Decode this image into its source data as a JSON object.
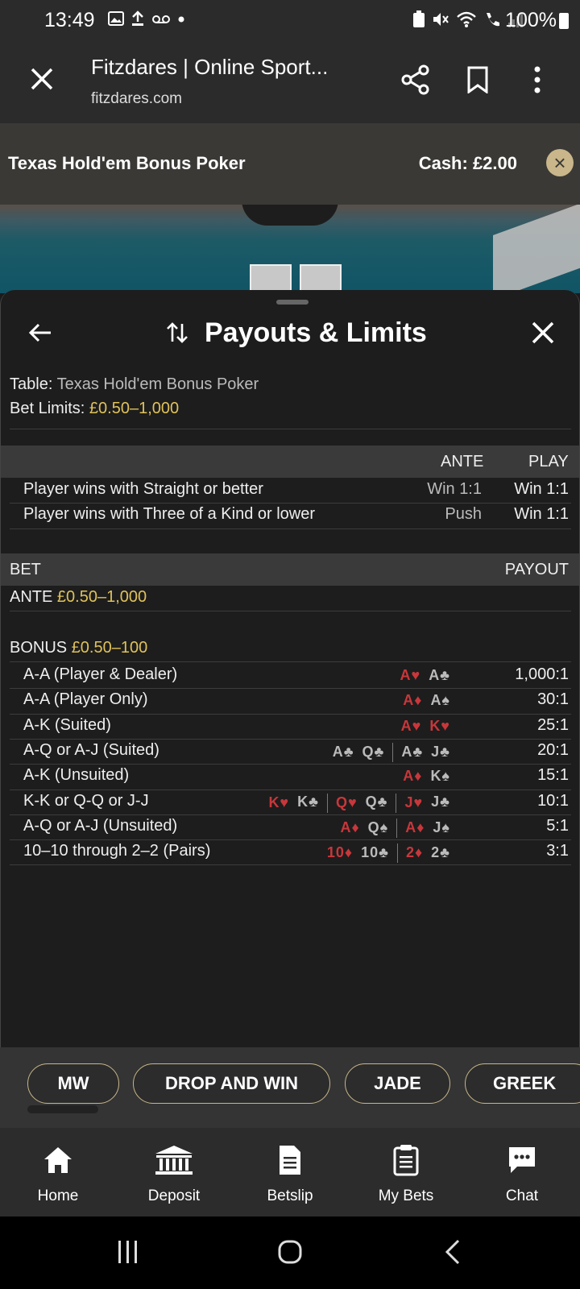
{
  "status_bar": {
    "time": "13:49",
    "battery": "100%"
  },
  "browser": {
    "title": "Fitzdares | Online Sport...",
    "url": "fitzdares.com",
    "icons": [
      "close-icon",
      "share-icon",
      "bookmark-icon",
      "more-vert-icon"
    ]
  },
  "game_bar": {
    "name": "Texas Hold'em Bonus Poker",
    "cash": "Cash: £2.00"
  },
  "panel": {
    "title": "Payouts & Limits",
    "table_label": "Table: ",
    "table_value": "Texas Hold'em Bonus Poker",
    "limits_label": "Bet Limits: ",
    "limits_value": "£0.50–1,000",
    "rules_header": {
      "ante": "ANTE",
      "play": "PLAY"
    },
    "rules": [
      {
        "label": "Player wins with Straight or better",
        "ante": "Win 1:1",
        "play": "Win 1:1"
      },
      {
        "label": "Player wins with Three of a Kind or lower",
        "ante": "Push",
        "play": "Win 1:1"
      }
    ],
    "bet_header": {
      "bet": "BET",
      "payout": "PAYOUT"
    },
    "ante_label": "ANTE ",
    "ante_limits": "£0.50–1,000",
    "bonus_label": "BONUS ",
    "bonus_limits": "£0.50–100",
    "bonus_rows": [
      {
        "hand": "A-A (Player & Dealer)",
        "payout": "1,000:1"
      },
      {
        "hand": "A-A (Player Only)",
        "payout": "30:1"
      },
      {
        "hand": "A-K (Suited)",
        "payout": "25:1"
      },
      {
        "hand": "A-Q or A-J (Suited)",
        "payout": "20:1"
      },
      {
        "hand": "A-K (Unsuited)",
        "payout": "15:1"
      },
      {
        "hand": "K-K or Q-Q or J-J",
        "payout": "10:1"
      },
      {
        "hand": "A-Q or A-J (Unsuited)",
        "payout": "5:1"
      },
      {
        "hand": "10–10 through 2–2 (Pairs)",
        "payout": "3:1"
      }
    ],
    "cards": {
      "r0": [
        [
          "A♥",
          "red"
        ],
        [
          "A♣",
          "blk"
        ]
      ],
      "r1": [
        [
          "A♦",
          "red"
        ],
        [
          "A♠",
          "blk"
        ]
      ],
      "r2": [
        [
          "A♥",
          "red"
        ],
        [
          "K♥",
          "red"
        ]
      ],
      "r3a": [
        [
          "A♣",
          "blk"
        ],
        [
          "Q♣",
          "blk"
        ]
      ],
      "r3b": [
        [
          "A♣",
          "blk"
        ],
        [
          "J♣",
          "blk"
        ]
      ],
      "r4": [
        [
          "A♦",
          "red"
        ],
        [
          "K♠",
          "blk"
        ]
      ],
      "r5a": [
        [
          "K♥",
          "red"
        ],
        [
          "K♣",
          "blk"
        ]
      ],
      "r5b": [
        [
          "Q♥",
          "red"
        ],
        [
          "Q♣",
          "blk"
        ]
      ],
      "r5c": [
        [
          "J♥",
          "red"
        ],
        [
          "J♣",
          "blk"
        ]
      ],
      "r6a": [
        [
          "A♦",
          "red"
        ],
        [
          "Q♠",
          "blk"
        ]
      ],
      "r6b": [
        [
          "A♦",
          "red"
        ],
        [
          "J♠",
          "blk"
        ]
      ],
      "r7a": [
        [
          "10♦",
          "red"
        ],
        [
          "10♣",
          "blk"
        ]
      ],
      "r7b": [
        [
          "2♦",
          "red"
        ],
        [
          "2♣",
          "blk"
        ]
      ]
    }
  },
  "chips": [
    "MW",
    "DROP AND WIN",
    "JADE",
    "GREEK"
  ],
  "bottom_nav": [
    {
      "label": "Home",
      "icon": "home-icon"
    },
    {
      "label": "Deposit",
      "icon": "bank-icon"
    },
    {
      "label": "Betslip",
      "icon": "betslip-icon"
    },
    {
      "label": "My Bets",
      "icon": "clipboard-icon"
    },
    {
      "label": "Chat",
      "icon": "chat-icon"
    }
  ],
  "colors": {
    "gold": "#e0c25a",
    "chip_border": "#c7b68a",
    "red_suit": "#c8373b"
  }
}
